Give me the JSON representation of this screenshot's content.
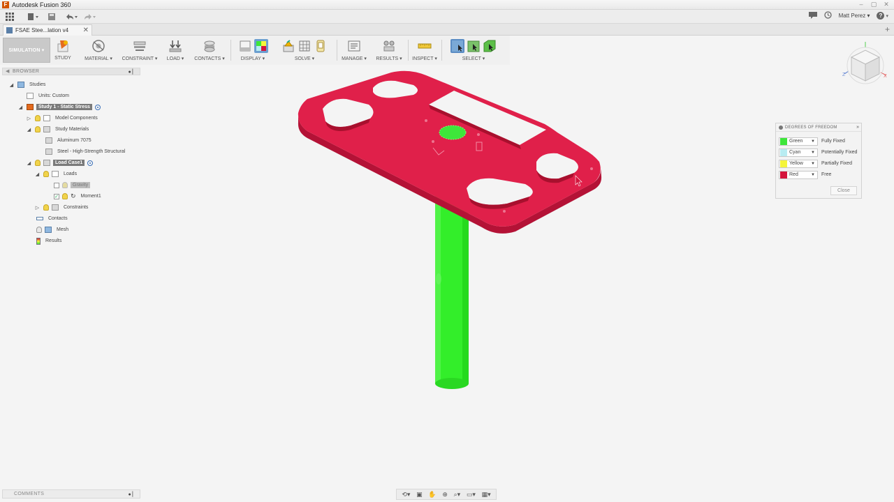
{
  "app": {
    "title": "Autodesk Fusion 360",
    "icon_letter": "F"
  },
  "qat": {
    "user": "Matt Perez ▾",
    "help": "?"
  },
  "document": {
    "tab_label": "FSAE Stee...lation v4",
    "close": "✕",
    "new_tab": "+"
  },
  "toolbar": {
    "workspace": "SIMULATION ▾",
    "groups": [
      {
        "label": "STUDY"
      },
      {
        "label": "MATERIAL ▾"
      },
      {
        "label": "CONSTRAINT ▾"
      },
      {
        "label": "LOAD ▾"
      },
      {
        "label": "CONTACTS ▾"
      },
      {
        "label": "DISPLAY ▾"
      },
      {
        "label": "SOLVE ▾"
      },
      {
        "label": "MANAGE ▾"
      },
      {
        "label": "RESULTS ▾"
      },
      {
        "label": "INSPECT ▾"
      },
      {
        "label": "SELECT ▾"
      }
    ]
  },
  "browser": {
    "header": "BROWSER",
    "nodes": [
      {
        "label": "Studies"
      },
      {
        "label": "Units: Custom"
      },
      {
        "label": "Study 1 - Static Stress"
      },
      {
        "label": "Model Components"
      },
      {
        "label": "Study Materials"
      },
      {
        "label": "Aluminum 7075"
      },
      {
        "label": "Steel - High-Strength Structural"
      },
      {
        "label": "Load Case1"
      },
      {
        "label": "Loads"
      },
      {
        "label": "Gravity"
      },
      {
        "label": "Moment1"
      },
      {
        "label": "Constraints"
      },
      {
        "label": "Contacts"
      },
      {
        "label": "Mesh"
      },
      {
        "label": "Results"
      }
    ]
  },
  "dof_panel": {
    "title": "DEGREES OF FREEDOM",
    "rows": [
      {
        "name": "Green",
        "color": "#3ee63a",
        "desc": "Fully Fixed"
      },
      {
        "name": "Cyan",
        "color": "#b8ecf2",
        "desc": "Potentially Fixed"
      },
      {
        "name": "Yellow",
        "color": "#f5f53a",
        "desc": "Partially Fixed"
      },
      {
        "name": "Red",
        "color": "#d4143c",
        "desc": "Free"
      }
    ],
    "close_label": "Close"
  },
  "comments": {
    "label": "COMMENTS"
  },
  "colors": {
    "plate_red": "#e0204a",
    "shaft_green": "#33ee2a",
    "accent_blue": "#3a6fb8"
  }
}
